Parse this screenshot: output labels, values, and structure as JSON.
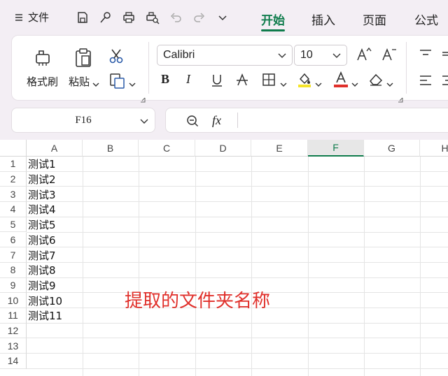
{
  "menu": {
    "label": "文件",
    "icon": "hamburger-icon"
  },
  "quick_access": [
    "save-icon",
    "brush-icon",
    "print-icon",
    "print-preview-icon",
    "undo-icon",
    "redo-icon",
    "chevron-down-icon"
  ],
  "tabs": [
    {
      "label": "开始",
      "active": true
    },
    {
      "label": "插入",
      "active": false
    },
    {
      "label": "页面",
      "active": false
    },
    {
      "label": "公式",
      "active": false
    }
  ],
  "ribbon": {
    "format_painter": "格式刷",
    "paste": "粘贴",
    "font_name": "Calibri",
    "font_size": "10"
  },
  "name_box": "F16",
  "formula_bar": {
    "fx_label": "fx",
    "value": ""
  },
  "columns": [
    {
      "label": "A",
      "selected": false
    },
    {
      "label": "B",
      "selected": false
    },
    {
      "label": "C",
      "selected": false
    },
    {
      "label": "D",
      "selected": false
    },
    {
      "label": "E",
      "selected": false
    },
    {
      "label": "F",
      "selected": true
    },
    {
      "label": "G",
      "selected": false
    },
    {
      "label": "H",
      "selected": false
    }
  ],
  "rows": [
    "1",
    "2",
    "3",
    "4",
    "5",
    "6",
    "7",
    "8",
    "9",
    "10",
    "11",
    "12",
    "13",
    "14"
  ],
  "cells_a": [
    "测试1",
    "测试2",
    "测试3",
    "测试4",
    "测试5",
    "测试6",
    "测试7",
    "测试8",
    "测试9",
    "测试10",
    "测试11"
  ],
  "annotation": "提取的文件夹名称",
  "colors": {
    "accent": "#0f7c4c",
    "annotation": "#e0302b",
    "highlight": "#f5e42a",
    "font_color": "#e0302b"
  }
}
